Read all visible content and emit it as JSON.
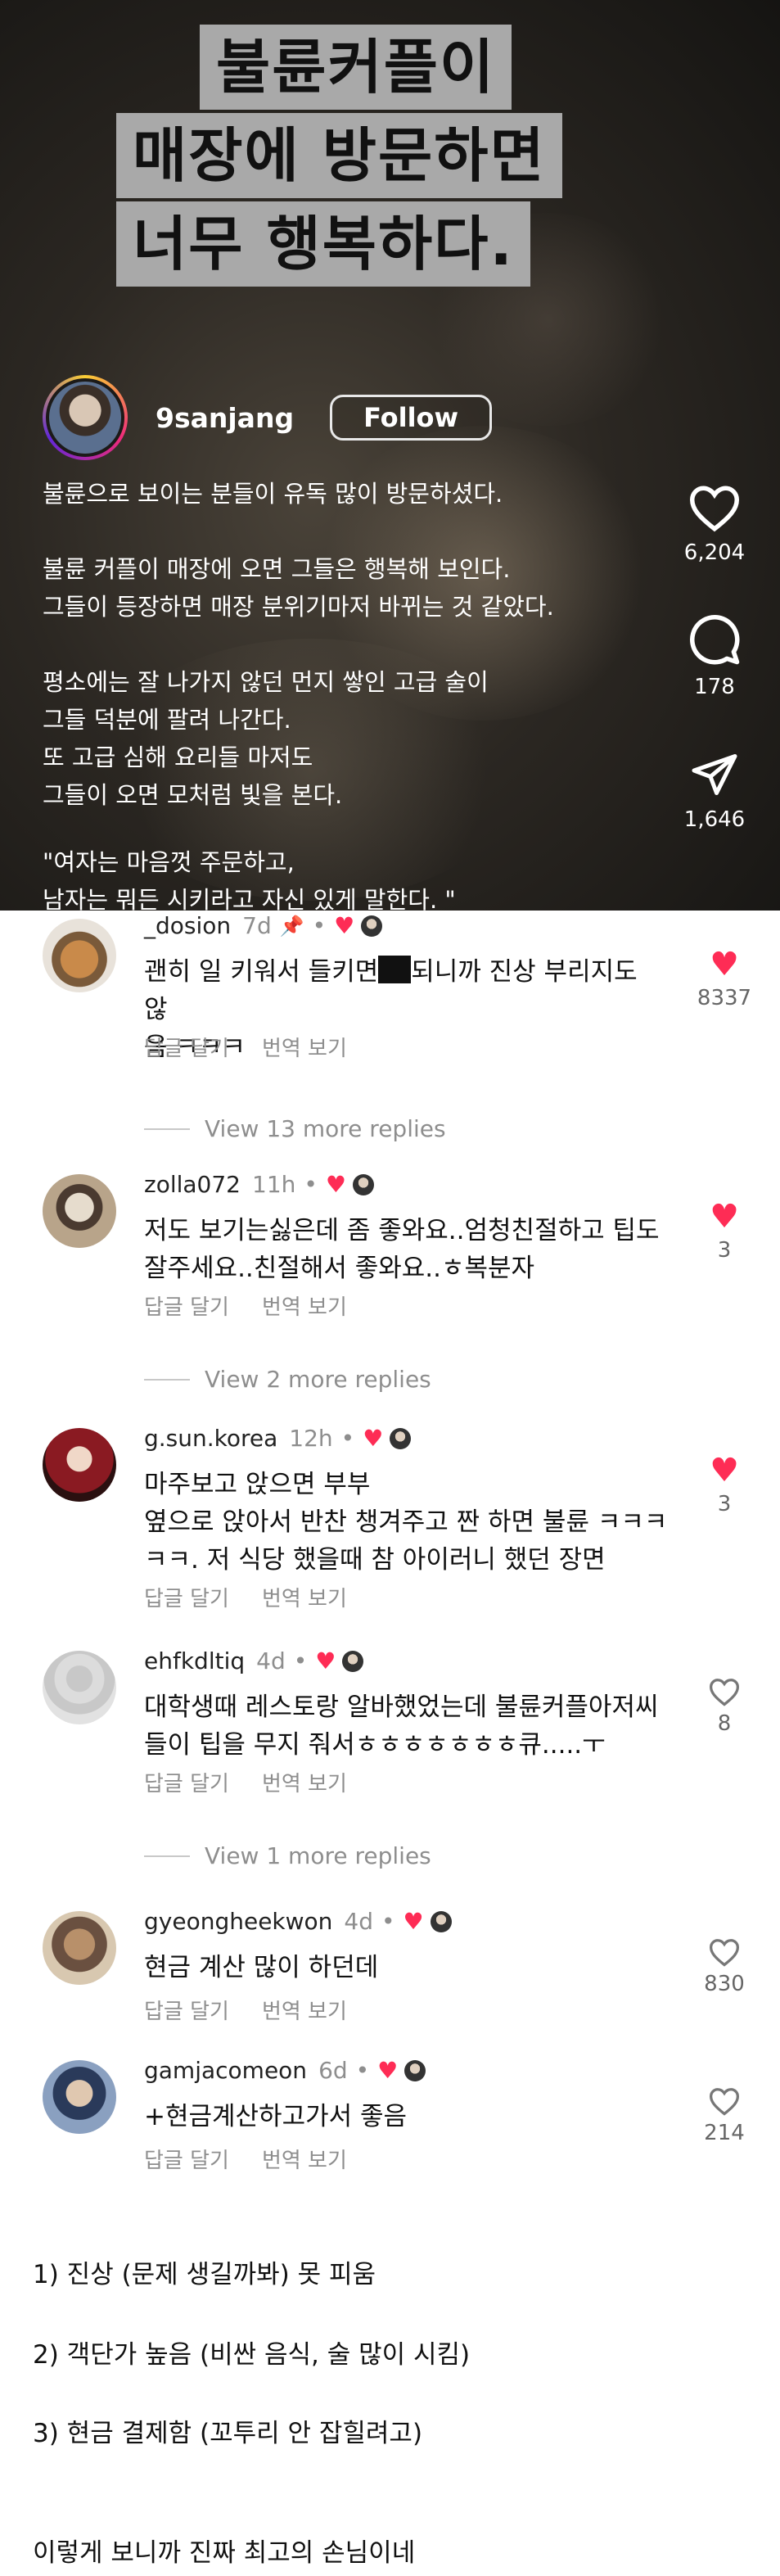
{
  "reel": {
    "caption_lines": [
      "불륜커플이",
      "매장에 방문하면",
      "너무 행복하다."
    ],
    "username": "9sanjang",
    "follow_label": "Follow",
    "text_paragraphs": [
      [
        "불륜으로 보이는 분들이 유독 많이 방문하셨다."
      ],
      [
        "불륜 커플이 매장에 오면 그들은 행복해 보인다.",
        "그들이 등장하면 매장 분위기마저 바뀌는 것 같았다."
      ],
      [
        "평소에는 잘 나가지 않던 먼지 쌓인 고급 술이",
        "그들 덕분에 팔려 나간다.",
        "또 고급 심해 요리들 마저도",
        "그들이 오면 모처럼 빛을 본다."
      ],
      [
        "\"여자는 마음껏 주문하고,",
        "남자는 뭐든 시키라고 자신 있게 말한다. \""
      ]
    ],
    "like_count": "6,204",
    "comment_count": "178",
    "share_count": "1,646",
    "icons": {
      "like": "heart-outline-icon",
      "comment": "comment-bubble-icon",
      "share": "send-icon"
    }
  },
  "comments": [
    {
      "username": "_dosion",
      "time": "7d",
      "pinned": true,
      "body_lines": [
        "괜히 일 키워서 들키면",
        "되니까 진상 부리지도 않",
        "음 ㅋㅋㅋ"
      ],
      "reply_label": "답글 달기",
      "translate_label": "번역 보기",
      "likes": "8337",
      "liked": true,
      "view_more": "View 13 more replies"
    },
    {
      "username": "zolla072",
      "time": "11h",
      "body_lines": [
        "저도 보기는싫은데 좀 좋와요..엄청친절하고 팁도",
        "잘주세요..친절해서 좋와요..ㅎ복분자"
      ],
      "reply_label": "답글 달기",
      "translate_label": "번역 보기",
      "likes": "3",
      "liked": true,
      "view_more": "View 2 more replies"
    },
    {
      "username": "g.sun.korea",
      "time": "12h",
      "body_lines": [
        "마주보고 앉으면 부부",
        "옆으로 앉아서 반찬 챙겨주고 짠 하면 불륜 ㅋㅋㅋ",
        "ㅋㅋ. 저 식당 했을때 참 아이러니 했던 장면"
      ],
      "reply_label": "답글 달기",
      "translate_label": "번역 보기",
      "likes": "3",
      "liked": true,
      "view_more": ""
    },
    {
      "username": "ehfkdltiq",
      "time": "4d",
      "body_lines": [
        "대학생때 레스토랑 알바했었는데 불륜커플아저씨",
        "들이 팁을 무지 줘서ㅎㅎㅎㅎㅎㅎㅎ큐.....ㅜ"
      ],
      "reply_label": "답글 달기",
      "translate_label": "번역 보기",
      "likes": "8",
      "liked": false,
      "view_more": "View 1 more replies"
    },
    {
      "username": "gyeongheekwon",
      "time": "4d",
      "body_lines": [
        "현금 계산 많이 하던데"
      ],
      "reply_label": "답글 달기",
      "translate_label": "번역 보기",
      "likes": "830",
      "liked": false,
      "view_more": ""
    },
    {
      "username": "gamjacomeon",
      "time": "6d",
      "body_lines": [
        "+현금계산하고가서 좋음"
      ],
      "reply_label": "답글 달기",
      "translate_label": "번역 보기",
      "likes": "214",
      "liked": false,
      "view_more": ""
    }
  ],
  "footer": {
    "points": [
      "1) 진상 (문제 생길까봐) 못 피움",
      "2) 객단가 높음 (비싼 음식, 술 많이 시킴)",
      "3) 현금 결제함 (꼬투리 안 잡힐려고)"
    ],
    "conclusion": "이렇게 보니까 진짜 최고의 손님이네"
  },
  "colors": {
    "like_red": "#fe2c55",
    "muted": "#8e8e8e",
    "caption_bg": "#a9a9a9"
  }
}
